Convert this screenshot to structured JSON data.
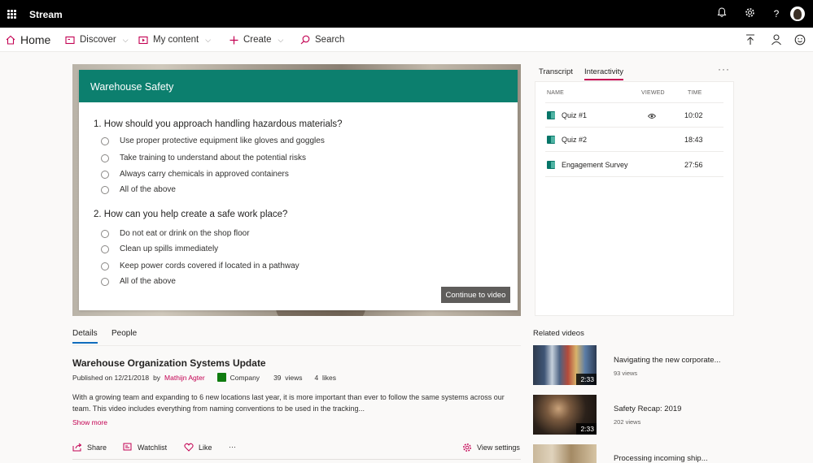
{
  "app": {
    "name": "Stream"
  },
  "topbar": {
    "icons": [
      "bell-icon",
      "gear-icon",
      "help-icon",
      "avatar"
    ]
  },
  "nav": {
    "home": "Home",
    "discover": "Discover",
    "my_content": "My content",
    "create": "Create",
    "search": "Search",
    "right_icons": [
      "upload-icon",
      "person-icon",
      "smiley-icon"
    ]
  },
  "quiz": {
    "title": "Warehouse Safety",
    "questions": [
      {
        "text": "1. How should you approach handling hazardous materials?",
        "options": [
          "Use proper protective equipment like gloves and goggles",
          "Take training to understand about the potential risks",
          "Always carry chemicals in approved containers",
          "All of the above"
        ]
      },
      {
        "text": "2. How can you help create a safe work place?",
        "options": [
          "Do not eat or drink on the shop floor",
          "Clean up spills immediately",
          "Keep power cords covered if located in a pathway",
          "All of the above"
        ]
      }
    ],
    "continue_label": "Continue to video"
  },
  "side_panel": {
    "tabs": [
      "Transcript",
      "Interactivity"
    ],
    "active_tab": "Interactivity",
    "more": "···",
    "columns": [
      "NAME",
      "VIEWED",
      "TIME"
    ],
    "rows": [
      {
        "name": "Quiz #1",
        "viewed": true,
        "time": "10:02"
      },
      {
        "name": "Quiz #2",
        "viewed": false,
        "time": "18:43"
      },
      {
        "name": "Engagement Survey",
        "viewed": false,
        "time": "27:56"
      }
    ]
  },
  "details": {
    "tabs": [
      "Details",
      "People"
    ],
    "active_tab": "Details",
    "title": "Warehouse Organization Systems Update",
    "published": "Published on 12/21/2018",
    "by": "by",
    "author": "Mathijn Agter",
    "group": "Company",
    "views": "39  views",
    "likes": "4  likes",
    "description": "With a growing team and expanding to 6 new locations last year, it is more important than ever to follow the same systems across our team. This video includes everything from naming conventions to be used in the tracking...",
    "show_more": "Show more",
    "actions": {
      "share": "Share",
      "watchlist": "Watchlist",
      "like": "Like",
      "more": "···",
      "view_settings": "View settings"
    }
  },
  "related": {
    "title": "Related videos",
    "videos": [
      {
        "name": "Navigating the new corporate...",
        "views": "93 views",
        "duration": "2:33"
      },
      {
        "name": "Safety Recap: 2019",
        "views": "202 views",
        "duration": "2:33"
      },
      {
        "name": "Processing incoming ship...",
        "views": "",
        "duration": ""
      }
    ]
  },
  "colors": {
    "accent": "#c30052",
    "quiz_header": "#0c7f6e",
    "topbar": "#000000"
  }
}
